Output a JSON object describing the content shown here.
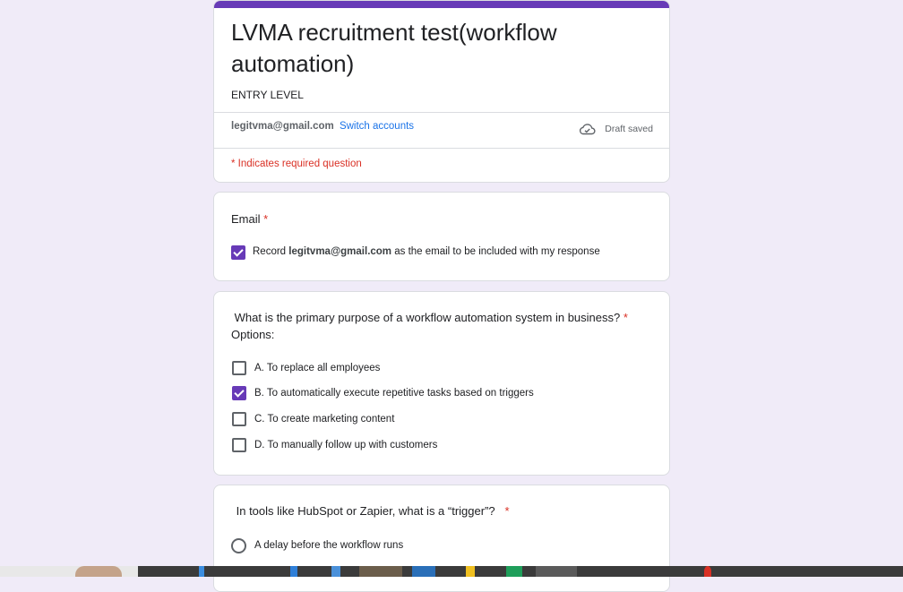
{
  "form": {
    "title": "LVMA recruitment test(workflow automation)",
    "description": "ENTRY LEVEL",
    "account_email": "legitvma@gmail.com",
    "switch_accounts": "Switch accounts",
    "draft_status": "Draft saved",
    "required_note": "* Indicates required question",
    "accent_color": "#673ab7"
  },
  "email_question": {
    "title": "Email",
    "required_mark": "*",
    "record_prefix": "Record",
    "record_email": "legitvma@gmail.com",
    "record_suffix": "as the email to be included with my response",
    "checked": true
  },
  "question1": {
    "title": " What is the primary purpose of a workflow automation system in business?",
    "required_mark": "*",
    "subtitle": "Options:",
    "options": [
      {
        "label": "A. To replace all employees",
        "checked": false
      },
      {
        "label": "B. To automatically execute repetitive tasks based on triggers",
        "checked": true
      },
      {
        "label": "C. To create marketing content",
        "checked": false
      },
      {
        "label": "D. To manually follow up with customers",
        "checked": false
      }
    ]
  },
  "question2": {
    "title": " In tools like HubSpot or Zapier, what is a “trigger”?",
    "required_mark": "*",
    "options": [
      {
        "label": "A delay before the workflow runs"
      }
    ]
  }
}
